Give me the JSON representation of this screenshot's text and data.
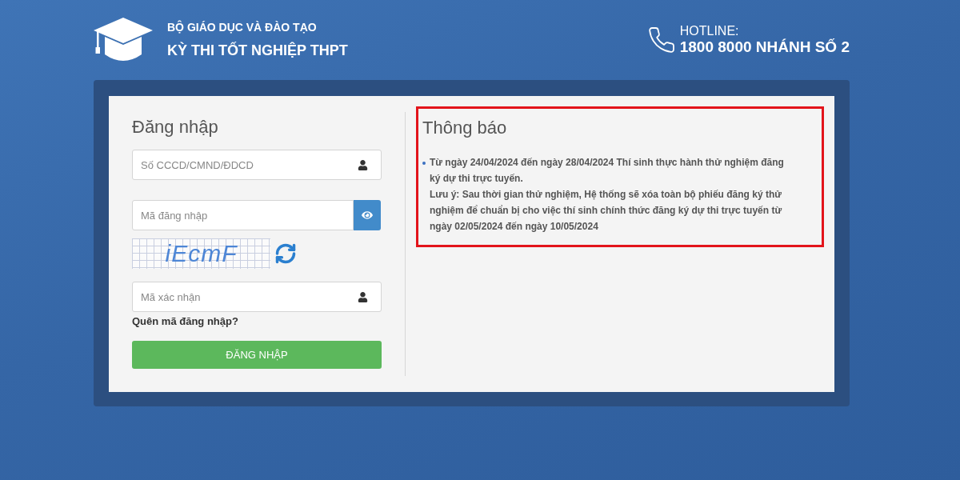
{
  "header": {
    "ministry": "BỘ GIÁO DỤC VÀ ĐÀO TẠO",
    "exam_title": "KỲ THI TỐT NGHIỆP THPT"
  },
  "hotline": {
    "label": "HOTLINE:",
    "number": "1800 8000 NHÁNH SỐ 2"
  },
  "login": {
    "title": "Đăng nhập",
    "id_field": {
      "placeholder": "Số CCCD/CMND/ĐDCD"
    },
    "password_field": {
      "placeholder": "Mã đăng nhập"
    },
    "captcha": {
      "text": "iEcmF"
    },
    "captcha_field": {
      "placeholder": "Mã xác nhận"
    },
    "forgot_link": "Quên mã đăng nhập?",
    "submit_button": "ĐĂNG NHẬP"
  },
  "notice": {
    "title": "Thông báo",
    "items": [
      {
        "paragraphs": [
          "Từ ngày 24/04/2024 đến ngày 28/04/2024 Thí sinh thực hành thử nghiệm đăng ký dự thi trực tuyến.",
          "Lưu ý: Sau thời gian thử nghiệm, Hệ thống sẽ xóa toàn bộ phiếu đăng ký thử nghiệm để chuẩn bị cho việc thí sinh chính thức đăng ký dự thi trực tuyến từ ngày 02/05/2024 đến ngày 10/05/2024"
        ]
      }
    ]
  }
}
